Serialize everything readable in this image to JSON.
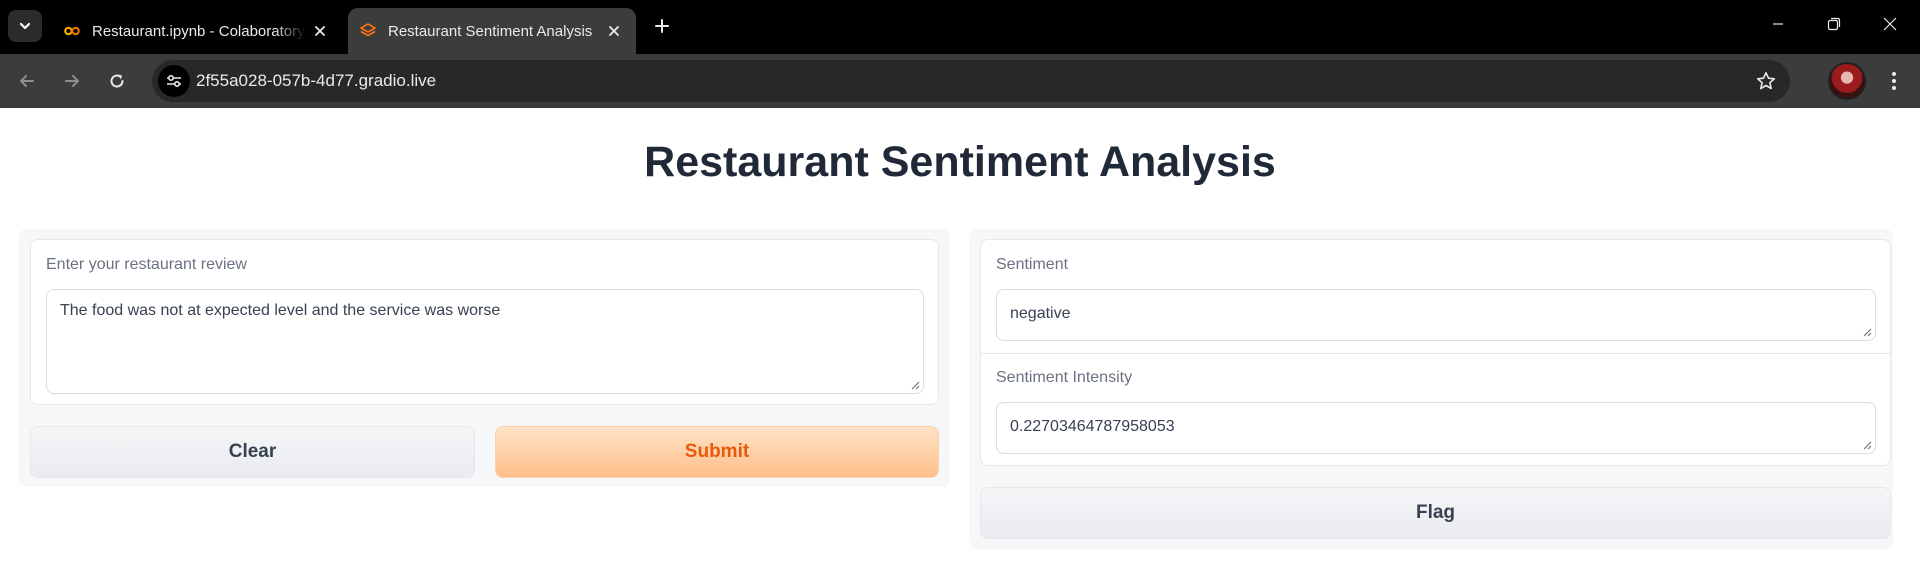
{
  "browser": {
    "tabs": [
      {
        "title": "Restaurant.ipynb - Colaboratory",
        "active": false,
        "favicon": "colab-icon"
      },
      {
        "title": "Restaurant Sentiment Analysis",
        "active": true,
        "favicon": "gradio-icon"
      }
    ],
    "url": "2f55a028-057b-4d77.gradio.live"
  },
  "app": {
    "title": "Restaurant Sentiment Analysis",
    "input": {
      "label": "Enter your restaurant review",
      "value": "The food was not at expected level and the service was worse"
    },
    "buttons": {
      "clear": "Clear",
      "submit": "Submit",
      "flag": "Flag"
    },
    "outputs": [
      {
        "label": "Sentiment",
        "value": "negative"
      },
      {
        "label": "Sentiment Intensity",
        "value": "0.22703464787958053"
      }
    ]
  },
  "colors": {
    "accent": "#ea580c",
    "primary_button": "#fed7aa",
    "chrome_dark": "#3c3c3c"
  }
}
